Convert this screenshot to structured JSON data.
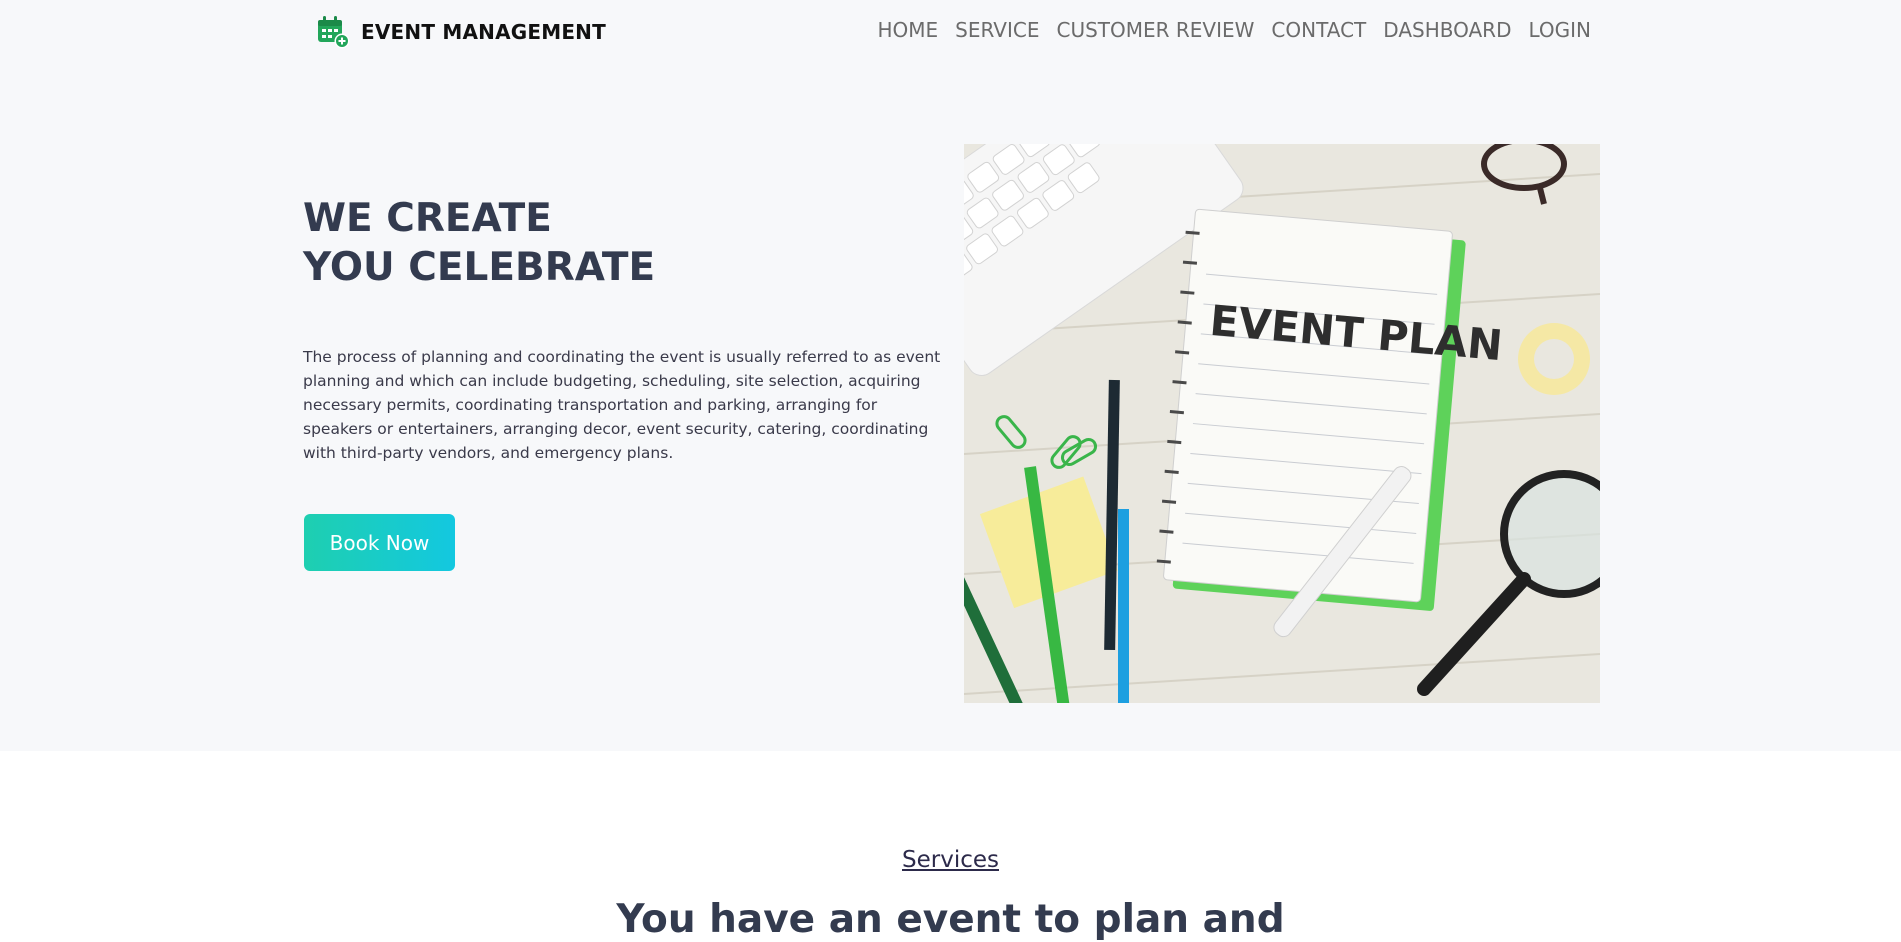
{
  "header": {
    "brand_name": "EVENT MANAGEMENT",
    "nav": [
      "HOME",
      "SERVICE",
      "CUSTOMER REVIEW",
      "CONTACT",
      "DASHBOARD",
      "LOGIN"
    ]
  },
  "hero": {
    "title_line1": "WE CREATE",
    "title_line2": "YOU CELEBRATE",
    "description": "The process of planning and coordinating the event is usually referred to as event planning and which can include budgeting, scheduling, site selection, acquiring necessary permits, coordinating transportation and parking, arranging for speakers or entertainers, arranging decor, event security, catering, coordinating with third-party vendors, and emergency plans.",
    "cta_label": "Book Now",
    "image_text": "EVENT PLAN"
  },
  "services": {
    "label": "Services",
    "heading": "You have an event to plan and"
  },
  "colors": {
    "hero_background": "#f7f8fa",
    "button_gradient_start": "#1ecfb0",
    "button_gradient_end": "#13c8e0",
    "brand_icon": "#22a65a",
    "heading_text": "#333b4f"
  }
}
